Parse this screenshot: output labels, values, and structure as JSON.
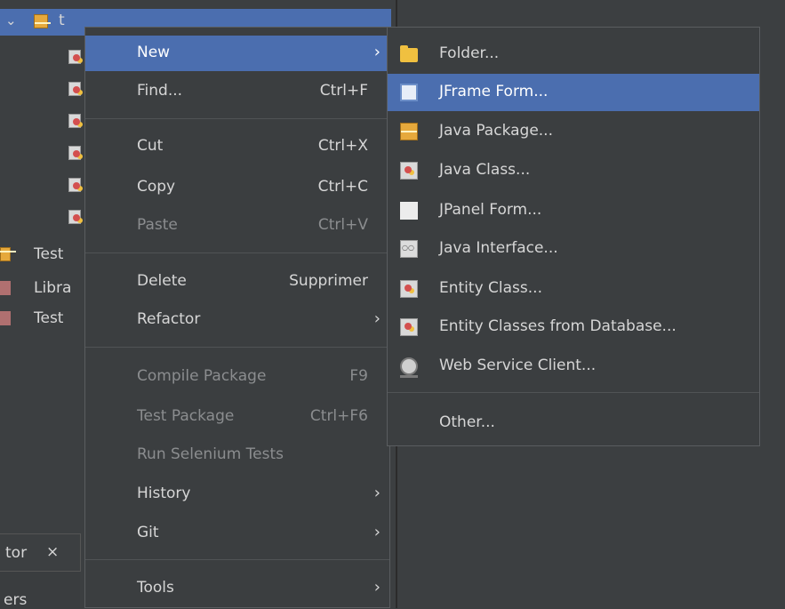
{
  "tree": {
    "selected_label": "t",
    "items": [
      "Test",
      "Libra",
      "Test"
    ],
    "footer_tab": "tor",
    "footer_close": "×",
    "footer_bottom": "ers"
  },
  "context_menu": {
    "items": [
      {
        "label": "New",
        "shortcut": "",
        "arrow": "›"
      },
      {
        "label": "Find...",
        "shortcut": "Ctrl+F",
        "arrow": ""
      },
      {
        "label": "Cut",
        "shortcut": "Ctrl+X",
        "arrow": ""
      },
      {
        "label": "Copy",
        "shortcut": "Ctrl+C",
        "arrow": ""
      },
      {
        "label": "Paste",
        "shortcut": "Ctrl+V",
        "arrow": ""
      },
      {
        "label": "Delete",
        "shortcut": "Supprimer",
        "arrow": ""
      },
      {
        "label": "Refactor",
        "shortcut": "",
        "arrow": "›"
      },
      {
        "label": "Compile Package",
        "shortcut": "F9",
        "arrow": ""
      },
      {
        "label": "Test Package",
        "shortcut": "Ctrl+F6",
        "arrow": ""
      },
      {
        "label": "Run Selenium Tests",
        "shortcut": "",
        "arrow": ""
      },
      {
        "label": "History",
        "shortcut": "",
        "arrow": "›"
      },
      {
        "label": "Git",
        "shortcut": "",
        "arrow": "›"
      },
      {
        "label": "Tools",
        "shortcut": "",
        "arrow": "›"
      }
    ]
  },
  "submenu": {
    "items": [
      {
        "label": "Folder...",
        "icon": "folder-icon"
      },
      {
        "label": "JFrame Form...",
        "icon": "jframe-icon"
      },
      {
        "label": "Java Package...",
        "icon": "package-icon"
      },
      {
        "label": "Java Class...",
        "icon": "java-class-icon"
      },
      {
        "label": "JPanel Form...",
        "icon": "jpanel-icon"
      },
      {
        "label": "Java Interface...",
        "icon": "interface-icon"
      },
      {
        "label": "Entity Class...",
        "icon": "entity-class-icon"
      },
      {
        "label": "Entity Classes from Database...",
        "icon": "entity-db-icon"
      },
      {
        "label": "Web Service Client...",
        "icon": "web-service-icon"
      },
      {
        "label": "Other...",
        "icon": ""
      }
    ]
  },
  "colors": {
    "background": "#3c3f41",
    "menu": "#3b3e40",
    "highlight": "#4b6eaf",
    "disabled_text": "#8b8d8f"
  }
}
